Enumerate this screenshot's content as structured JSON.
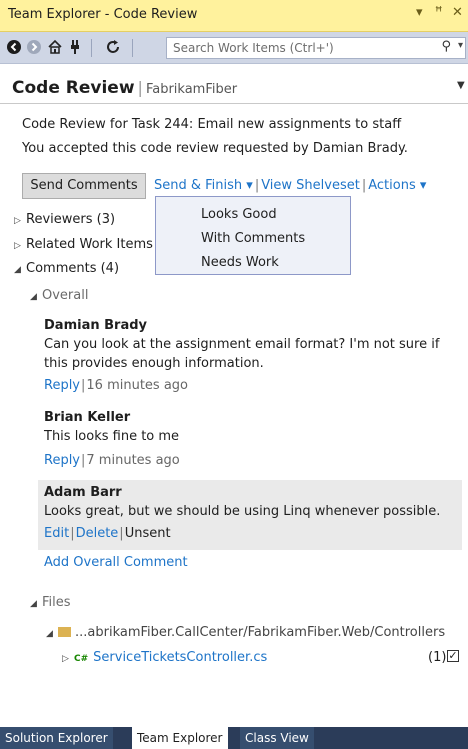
{
  "window": {
    "title": "Team Explorer - Code Review",
    "controls": {
      "dropdown": "▾",
      "pin": "ꟸ",
      "close": "✕"
    }
  },
  "toolbar": {
    "search_placeholder": "Search Work Items (Ctrl+')",
    "search_icon_glyph": "⚲",
    "search_dropdown_glyph": "▾"
  },
  "header": {
    "title": "Code Review",
    "project": "FabrikamFiber"
  },
  "review": {
    "task_line": "Code Review for Task 244: Email new assignments to staff",
    "status_line": "You accepted this code review requested by Damian Brady."
  },
  "actions": {
    "send_comments": "Send Comments",
    "send_finish": "Send & Finish ▾",
    "view_shelveset": "View Shelveset",
    "actions": "Actions ▾"
  },
  "send_finish_menu": [
    "Looks Good",
    "With Comments",
    "Needs Work"
  ],
  "sections": {
    "reviewers": "Reviewers (3)",
    "related": "Related Work Items",
    "comments": "Comments (4)",
    "overall": "Overall",
    "files": "Files"
  },
  "comments": [
    {
      "author": "Damian Brady",
      "line1": "Can you look at the assignment email format? I'm not sure if",
      "line2": "this provides enough information.",
      "reply": "Reply",
      "time": "16 minutes ago"
    },
    {
      "author": "Brian Keller",
      "line1": "This looks fine to me",
      "reply": "Reply",
      "time": "7 minutes ago"
    },
    {
      "author": "Adam Barr",
      "line1": "Looks great, but we should be using Linq whenever possible.",
      "edit": "Edit",
      "delete": "Delete",
      "status": "Unsent"
    }
  ],
  "add_overall_comment": "Add Overall Comment",
  "files": {
    "folder_path": "...abrikamFiber.CallCenter/FabrikamFiber.Web/Controllers",
    "file_lang": "C#",
    "file_name": "ServiceTicketsController.cs",
    "file_count": "(1)",
    "checked": true
  },
  "bottom_tabs": [
    "Solution Explorer",
    "Team Explorer",
    "Class View"
  ],
  "colors": {
    "title_bar": "#fff29d",
    "toolbar": "#cfd6e5",
    "link": "#1e74c8",
    "tab_strip": "#2b3c59"
  }
}
